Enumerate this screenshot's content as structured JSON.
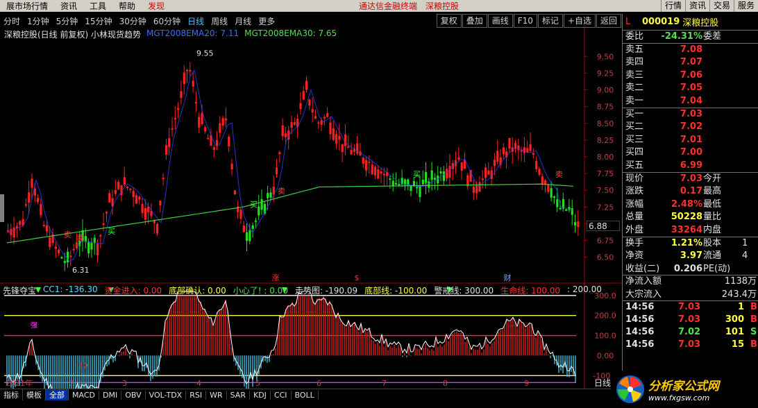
{
  "menubar": {
    "items": [
      "展市场行情",
      "资讯",
      "工具",
      "帮助",
      "发现"
    ],
    "center": [
      "通达信金融终端",
      "深粮控股"
    ],
    "right": [
      "行情",
      "资讯",
      "交易",
      "服务"
    ]
  },
  "toolbar": {
    "periods": [
      "分时",
      "1分钟",
      "5分钟",
      "15分钟",
      "30分钟",
      "60分钟",
      "日线",
      "周线",
      "月线",
      "更多"
    ],
    "active": "日线",
    "right_buttons": [
      "复权",
      "叠加",
      "画线",
      "F10",
      "标记",
      "+自选",
      "返回"
    ]
  },
  "indicator": {
    "title": "深粮控股(日线 前复权) 小林现货趋势",
    "ma1": "MGT2008EMA20: 7.11",
    "ma2": "MGT2008EMA30: 7.65"
  },
  "sub_indicator": {
    "name": "先锋夺宝",
    "cc1": "CC1: -136.30",
    "fund": "资金进入: 0.00",
    "confirm": "底部确认: 0.00",
    "careful": "小心了! : 0.00",
    "trend": "走势图: -190.09",
    "bottom": "底部线: -100.00",
    "warn": "警戒线: 300.00",
    "life": "生命线: 100.00",
    "val200": ": 200.00"
  },
  "chart_data": {
    "type": "candlestick",
    "ylim": [
      6.3,
      9.7
    ],
    "y_ticks": [
      "9.50",
      "9.25",
      "9.00",
      "8.75",
      "8.50",
      "8.25",
      "8.00",
      "7.75",
      "7.50",
      "7.25",
      "7.00",
      "6.75",
      "6.50"
    ],
    "sub_ticks": [
      "300.0",
      "200.0",
      "100.0",
      "0.00",
      "-100.0"
    ],
    "annotations": {
      "high": "9.55",
      "low": "6.31",
      "last": "6.88"
    },
    "x_labels": [
      "2021年",
      "2",
      "3",
      "4",
      "5",
      "6",
      "7",
      "8",
      "9"
    ],
    "markers": [
      "涨",
      "$",
      "财"
    ],
    "signals": [
      "卖",
      "买",
      "买",
      "卖",
      "买",
      "卖",
      "卖"
    ],
    "sub_labels": [
      "强",
      "-30"
    ]
  },
  "bottom_tabs": [
    "指标",
    "模板",
    "全部",
    "MACD",
    "DMI",
    "OBV",
    "VOL-TDX",
    "RSI",
    "WR",
    "SAR",
    "KDJ",
    "CCI",
    "BOLL"
  ],
  "bottom_active": "全部",
  "day_tab": "日线",
  "quote": {
    "flag": "L",
    "code": "000019",
    "name": "深粮控股",
    "weibi": {
      "label": "委比",
      "value": "-24.31%",
      "label2": "委差"
    },
    "sells": [
      {
        "label": "卖五",
        "price": "7.08"
      },
      {
        "label": "卖四",
        "price": "7.07"
      },
      {
        "label": "卖三",
        "price": "7.06"
      },
      {
        "label": "卖二",
        "price": "7.05"
      },
      {
        "label": "卖一",
        "price": "7.04"
      }
    ],
    "buys": [
      {
        "label": "买一",
        "price": "7.03"
      },
      {
        "label": "买二",
        "price": "7.02"
      },
      {
        "label": "买三",
        "price": "7.01"
      },
      {
        "label": "买四",
        "price": "7.00"
      },
      {
        "label": "买五",
        "price": "6.99"
      }
    ],
    "stats": [
      {
        "label": "现价",
        "value": "7.03",
        "label2": "今开",
        "color": "#ff3030"
      },
      {
        "label": "涨跌",
        "value": "0.17",
        "label2": "最高",
        "color": "#ff3030"
      },
      {
        "label": "涨幅",
        "value": "2.48%",
        "label2": "最低",
        "color": "#ff3030"
      },
      {
        "label": "总量",
        "value": "50228",
        "label2": "量比",
        "color": "#ffff40"
      },
      {
        "label": "外盘",
        "value": "33264",
        "label2": "内盘",
        "color": "#ff3030"
      }
    ],
    "stats2": [
      {
        "label": "换手",
        "value": "1.21%",
        "label2": "股本",
        "v2": "1"
      },
      {
        "label": "净资",
        "value": "3.97",
        "label2": "流通",
        "v2": "4"
      },
      {
        "label": "收益(二)",
        "value": "0.206",
        "label2": "PE(动)",
        "v2": ""
      }
    ],
    "flows": [
      {
        "label": "净流入额",
        "value": "1138万"
      },
      {
        "label": "大宗流入",
        "value": "243.4万"
      }
    ],
    "ticks": [
      {
        "time": "14:56",
        "price": "7.03",
        "vol": "1",
        "bs": "B"
      },
      {
        "time": "14:56",
        "price": "7.03",
        "vol": "300",
        "bs": "B"
      },
      {
        "time": "14:56",
        "price": "7.02",
        "vol": "101",
        "bs": "S"
      },
      {
        "time": "14:56",
        "price": "7.03",
        "vol": "15",
        "bs": "B"
      }
    ]
  },
  "logo": {
    "name": "分析家公式网",
    "url": "www.fxgsw.com"
  }
}
